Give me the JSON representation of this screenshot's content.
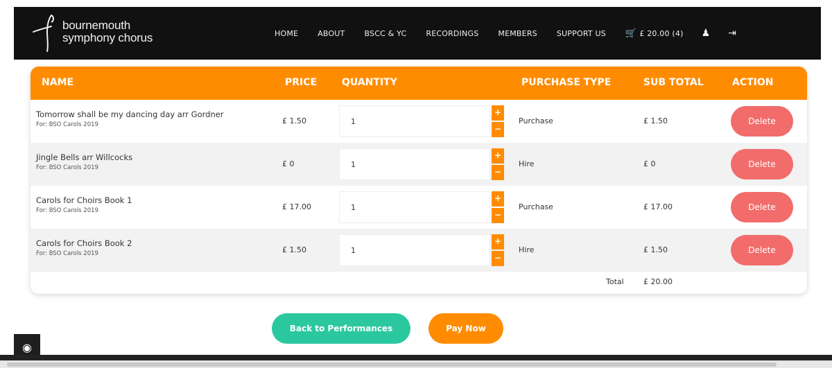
{
  "brand": {
    "line1": "bournemouth",
    "line2": "symphony chorus"
  },
  "nav": {
    "items": [
      "HOME",
      "ABOUT",
      "BSCC & YC",
      "RECORDINGS",
      "MEMBERS",
      "SUPPORT US"
    ],
    "cart_label": "£ 20.00 (4)",
    "cart_icon": "cart-icon",
    "user_icon": "user-icon",
    "logout_icon": "logout-icon"
  },
  "table": {
    "headers": {
      "name": "NAME",
      "price": "PRICE",
      "quantity": "QUANTITY",
      "purchase_type": "PURCHASE TYPE",
      "sub_total": "SUB TOTAL",
      "action": "ACTION"
    },
    "rows": [
      {
        "name": "Tomorrow shall be my dancing day arr Gordner",
        "for": "For: BSO Carols 2019",
        "price": "£ 1.50",
        "quantity": "1",
        "type": "Purchase",
        "subtotal": "£ 1.50",
        "action": "Delete"
      },
      {
        "name": "Jingle Bells arr Willcocks",
        "for": "For: BSO Carols 2019",
        "price": "£ 0",
        "quantity": "1",
        "type": "Hire",
        "subtotal": "£ 0",
        "action": "Delete"
      },
      {
        "name": "Carols for Choirs Book 1",
        "for": "For: BSO Carols 2019",
        "price": "£ 17.00",
        "quantity": "1",
        "type": "Purchase",
        "subtotal": "£ 17.00",
        "action": "Delete"
      },
      {
        "name": "Carols for Choirs Book 2",
        "for": "For: BSO Carols 2019",
        "price": "£ 1.50",
        "quantity": "1",
        "type": "Hire",
        "subtotal": "£ 1.50",
        "action": "Delete"
      }
    ],
    "total_label": "Total",
    "total_value": "£ 20.00",
    "stepper_plus": "+",
    "stepper_minus": "−"
  },
  "actions": {
    "back": "Back to Performances",
    "pay": "Pay Now"
  },
  "colors": {
    "accent": "#ff8c00",
    "teal": "#2bc8a0",
    "delete": "#f26c6c",
    "nav_bg": "#111111"
  }
}
